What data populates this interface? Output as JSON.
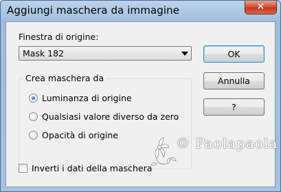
{
  "window": {
    "title": "Aggiungi maschera da immagine",
    "close_glyph": "✕"
  },
  "source": {
    "label": "Finestra di origine:",
    "selected": "Mask 182"
  },
  "buttons": {
    "ok": "OK",
    "cancel": "Annulla",
    "help": "?"
  },
  "group": {
    "title": "Crea maschera da",
    "options": [
      {
        "label": "Luminanza di origine",
        "selected": true
      },
      {
        "label": "Qualsiasi valore diverso da zero",
        "selected": false
      },
      {
        "label": "Opacità di origine",
        "selected": false
      }
    ]
  },
  "invert": {
    "label": "Inverti i dati della maschera",
    "checked": false
  },
  "watermark": {
    "text": "Paolapaola"
  },
  "colors": {
    "title_bar": "#a9c4e0",
    "close_button": "#c4371e",
    "client_bg": "#f0f0f0",
    "default_button_border": "#3c7fb1"
  }
}
